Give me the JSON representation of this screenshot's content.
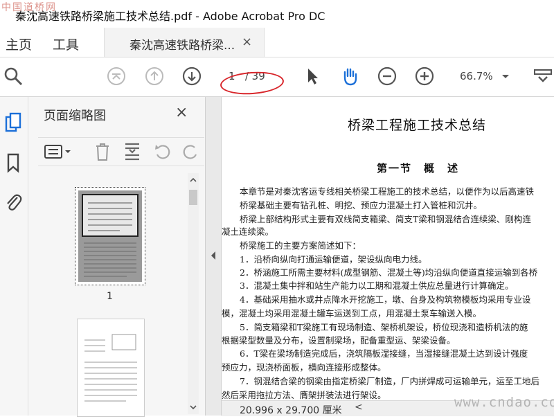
{
  "window": {
    "title": "秦沈高速铁路桥梁施工技术总结.pdf - Adobe Acrobat Pro DC",
    "watermark_top": "中国道桥网"
  },
  "menu": {
    "home": "主页",
    "tools": "工具"
  },
  "tab": {
    "label": "秦沈高速铁路桥梁...",
    "close": "×"
  },
  "toolbar": {
    "page_current": "1",
    "page_total": "/ 39",
    "zoom": "66.7%",
    "accent": "#1b6fd8",
    "annotation_color": "#d8262b"
  },
  "left_rail": {
    "icons": [
      "page-thumbnails-icon",
      "bookmark-icon",
      "attachment-icon"
    ]
  },
  "panel": {
    "title": "页面缩略图",
    "close": "×",
    "thumb1_label": "1",
    "tools": [
      "options-menu-icon",
      "delete-icon",
      "insert-page-icon",
      "rotate-ccw-icon",
      "rotate-cw-icon"
    ]
  },
  "document": {
    "title": "桥梁工程施工技术总结",
    "section": "第一节　概　述",
    "lines": [
      "本章节是对秦沈客运专线相关桥梁工程施工的技术总结，以便作为以后高速铁",
      "桥梁基础主要有钻孔桩、明挖、预应力混凝土打入管桩和沉井。",
      "桥梁上部结构形式主要有双线简支箱梁、简支T梁和钢混结合连续梁、刚构连",
      "凝土连续梁。",
      "桥梁施工的主要方案简述如下：",
      "1．沿桥向纵向打通运输便道，架设纵向电力线。",
      "2．桥涵施工所需主要材料(成型钢筋、混凝土等)均沿纵向便道直接运输到各桥",
      "3．混凝土集中拌和站生产能力以工期和混凝土供应总量进行计算确定。",
      "4．基础采用抽水或井点降水开挖施工，墩、台身及构筑物模板均采用专业设",
      "模，混凝土均采用混凝土罐车运送到工点，用混凝土泵车输送入模。",
      "5．简支箱梁和T梁施工有现场制造、架桥机架设，桥位现浇和造桥机法的施",
      "根据梁型数量及分布，设置制梁场，配备重型运、架梁设备。",
      "6．T梁在梁场制造完成后，浇筑隔板湿接缝，当湿接缝混凝土达到设计强度",
      "预应力，现浇桥面板，横向连接形成整体。",
      "7．钢混结合梁的钢梁由指定桥梁厂制造，厂内拼焊成可运输单元，运至工地后",
      "然后采用拖拉方法、膺架拼装法进行架设。"
    ]
  },
  "status": {
    "page_size": "20.996 x 29.700 厘米",
    "scroll_left": "<"
  },
  "watermark_bottom": "www.cndao.com"
}
